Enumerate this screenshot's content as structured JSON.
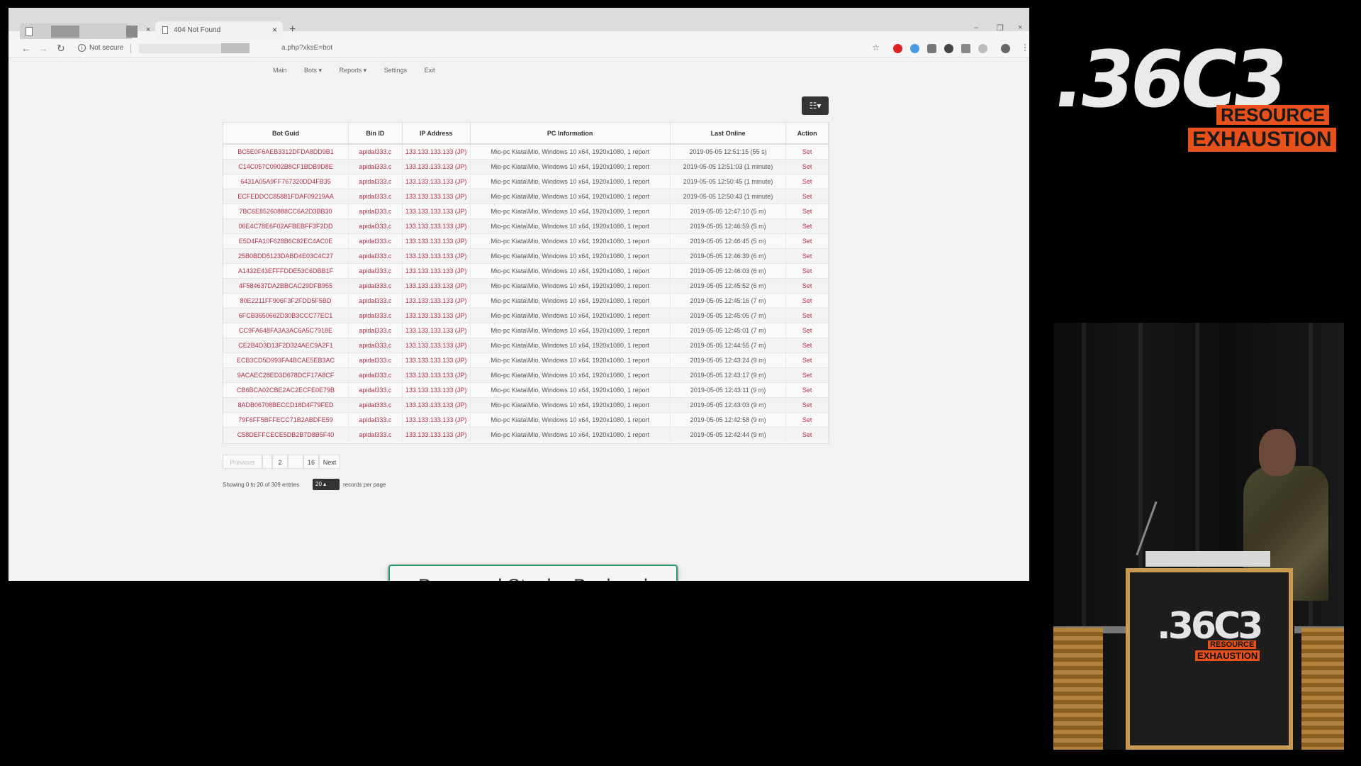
{
  "browser": {
    "active_tab_title": "404 Not Found",
    "new_tab_label": "+",
    "close_label": "×",
    "security_label": "Not secure",
    "url": "a.php?xksE=bot",
    "window_controls": [
      "–",
      "❐",
      "×"
    ]
  },
  "nav": {
    "items": [
      "Main",
      "Bots ▾",
      "Reports ▾",
      "Settings",
      "Exit"
    ]
  },
  "table": {
    "columns": [
      "Bot Guid",
      "Bin ID",
      "IP Address",
      "PC Information",
      "Last Online",
      "Action"
    ],
    "rows": [
      [
        "BC5E0F6AEB3312DFDA8DD9B1",
        "apidal333.c",
        "133.133.133.133 (JP)",
        "Mio-pc Kiata\\Mio, Windows 10 x64, 1920x1080, 1 report",
        "2019-05-05 12:51:15 (55 s)",
        "Set"
      ],
      [
        "C14C057C0902B8CF1BDB9D8E",
        "apidal333.c",
        "133.133.133.133 (JP)",
        "Mio-pc Kiata\\Mio, Windows 10 x64, 1920x1080, 1 report",
        "2019-05-05 12:51:03 (1 minute)",
        "Set"
      ],
      [
        "6431A05A9FF767320DD4FB35",
        "apidal333.c",
        "133.133.133.133 (JP)",
        "Mio-pc Kiata\\Mio, Windows 10 x64, 1920x1080, 1 report",
        "2019-05-05 12:50:45 (1 minute)",
        "Set"
      ],
      [
        "ECFEDDCC85881FDAF09219AA",
        "apidal333.c",
        "133.133.133.133 (JP)",
        "Mio-pc Kiata\\Mio, Windows 10 x64, 1920x1080, 1 report",
        "2019-05-05 12:50:43 (1 minute)",
        "Set"
      ],
      [
        "7BC6E85260888CC6A2D3BB30",
        "apidal333.c",
        "133.133.133.133 (JP)",
        "Mio-pc Kiata\\Mio, Windows 10 x64, 1920x1080, 1 report",
        "2019-05-05 12:47:10 (5 m)",
        "Set"
      ],
      [
        "06E4C78E6F02AFBEBFF3F2DD",
        "apidal333.c",
        "133.133.133.133 (JP)",
        "Mio-pc Kiata\\Mio, Windows 10 x64, 1920x1080, 1 report",
        "2019-05-05 12:46:59 (5 m)",
        "Set"
      ],
      [
        "E5D4FA10F628B6C82EC4AC0E",
        "apidal333.c",
        "133.133.133.133 (JP)",
        "Mio-pc Kiata\\Mio, Windows 10 x64, 1920x1080, 1 report",
        "2019-05-05 12:46:45 (5 m)",
        "Set"
      ],
      [
        "25B0BDD5123DABD4E03C4C27",
        "apidal333.c",
        "133.133.133.133 (JP)",
        "Mio-pc Kiata\\Mio, Windows 10 x64, 1920x1080, 1 report",
        "2019-05-05 12:46:39 (6 m)",
        "Set"
      ],
      [
        "A1432E43EFFFDDE53C6DBB1F",
        "apidal333.c",
        "133.133.133.133 (JP)",
        "Mio-pc Kiata\\Mio, Windows 10 x64, 1920x1080, 1 report",
        "2019-05-05 12:46:03 (6 m)",
        "Set"
      ],
      [
        "4F584637DA2BBCAC29DFB955",
        "apidal333.c",
        "133.133.133.133 (JP)",
        "Mio-pc Kiata\\Mio, Windows 10 x64, 1920x1080, 1 report",
        "2019-05-05 12:45:52 (6 m)",
        "Set"
      ],
      [
        "80E2211FF906F3F2FDD5F5BD",
        "apidal333.c",
        "133.133.133.133 (JP)",
        "Mio-pc Kiata\\Mio, Windows 10 x64, 1920x1080, 1 report",
        "2019-05-05 12:45:16 (7 m)",
        "Set"
      ],
      [
        "6FCB3650662D30B3CCC77EC1",
        "apidal333.c",
        "133.133.133.133 (JP)",
        "Mio-pc Kiata\\Mio, Windows 10 x64, 1920x1080, 1 report",
        "2019-05-05 12:45:05 (7 m)",
        "Set"
      ],
      [
        "CC9FA648FA3A3AC6A5C7918E",
        "apidal333.c",
        "133.133.133.133 (JP)",
        "Mio-pc Kiata\\Mio, Windows 10 x64, 1920x1080, 1 report",
        "2019-05-05 12:45:01 (7 m)",
        "Set"
      ],
      [
        "CE2B4D3D13F2D324AEC9A2F1",
        "apidal333.c",
        "133.133.133.133 (JP)",
        "Mio-pc Kiata\\Mio, Windows 10 x64, 1920x1080, 1 report",
        "2019-05-05 12:44:55 (7 m)",
        "Set"
      ],
      [
        "ECB3CD5D993FA4BCAE5EB3AC",
        "apidal333.c",
        "133.133.133.133 (JP)",
        "Mio-pc Kiata\\Mio, Windows 10 x64, 1920x1080, 1 report",
        "2019-05-05 12:43:24 (9 m)",
        "Set"
      ],
      [
        "9ACAEC28ED3D678DCF17A8CF",
        "apidal333.c",
        "133.133.133.133 (JP)",
        "Mio-pc Kiata\\Mio, Windows 10 x64, 1920x1080, 1 report",
        "2019-05-05 12:43:17 (9 m)",
        "Set"
      ],
      [
        "CB6BCA02CBE2AC2ECFE0E79B",
        "apidal333.c",
        "133.133.133.133 (JP)",
        "Mio-pc Kiata\\Mio, Windows 10 x64, 1920x1080, 1 report",
        "2019-05-05 12:43:11 (9 m)",
        "Set"
      ],
      [
        "8ADB06708BECCD18D4F79FED",
        "apidal333.c",
        "133.133.133.133 (JP)",
        "Mio-pc Kiata\\Mio, Windows 10 x64, 1920x1080, 1 report",
        "2019-05-05 12:43:03 (9 m)",
        "Set"
      ],
      [
        "79F6FF5BFFECC71B2ABDFE59",
        "apidal333.c",
        "133.133.133.133 (JP)",
        "Mio-pc Kiata\\Mio, Windows 10 x64, 1920x1080, 1 report",
        "2019-05-05 12:42:58 (9 m)",
        "Set"
      ],
      [
        "C58DEFFCECE5DB2B7D8B5F40",
        "apidal333.c",
        "133.133.133.133 (JP)",
        "Mio-pc Kiata\\Mio, Windows 10 x64, 1920x1080, 1 report",
        "2019-05-05 12:42:44 (9 m)",
        "Set"
      ]
    ]
  },
  "pagination": {
    "previous": "Previous",
    "pages": [
      "",
      "2",
      "",
      "16"
    ],
    "next": "Next"
  },
  "footer": {
    "showing": "Showing 0 to 20 of 309 entries",
    "per_page_value": "20",
    "per_page_label": "records per page"
  },
  "caption": "Password Stealer Backend",
  "event_logo": {
    "main": ".36C3",
    "line1": "RESOURCE",
    "line2": "EXHAUSTION"
  },
  "colors": {
    "link_red": "#b0304a",
    "caption_border": "#2a9a6a",
    "logo_orange": "#e8501c"
  }
}
